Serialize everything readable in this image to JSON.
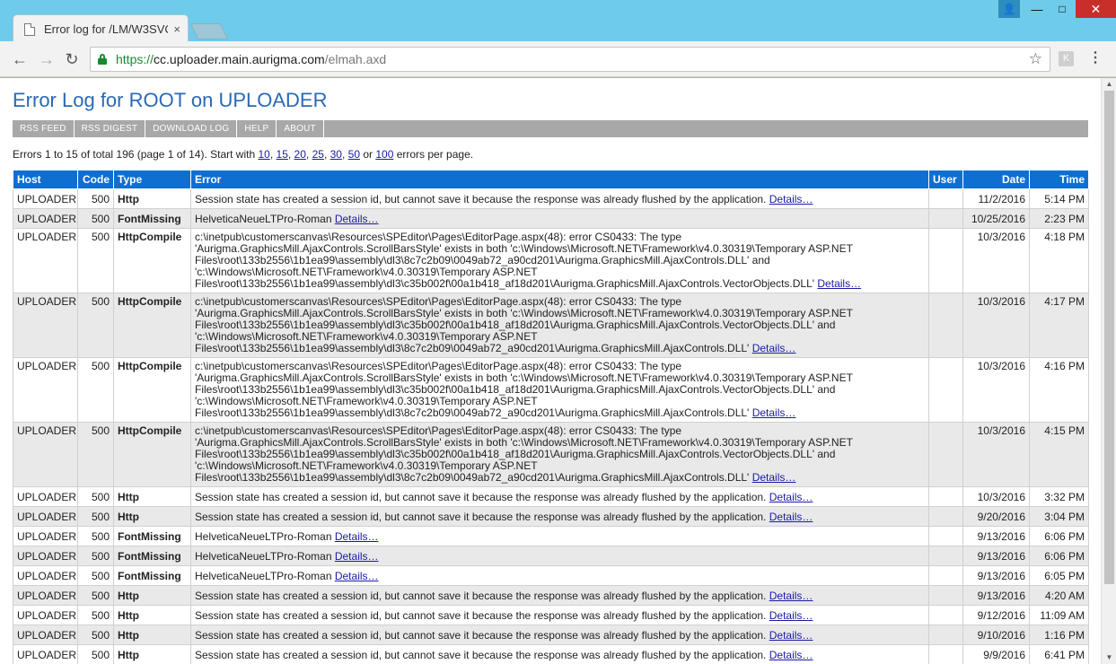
{
  "browser": {
    "tab_title": "Error log for /LM/W3SVC",
    "tab_close": "×",
    "url_scheme": "https://",
    "url_host": "cc.uploader.main.aurigma.com",
    "url_path": "/elmah.axd",
    "extension_label": "K",
    "icons": {
      "back": "←",
      "forward": "→",
      "reload": "↻",
      "star": "☆",
      "menu": "⋮",
      "user": "👤",
      "minimize": "—",
      "maximize": "□",
      "close": "✕"
    }
  },
  "page": {
    "title": "Error Log for ROOT on UPLOADER",
    "speedbar": [
      "RSS FEED",
      "RSS DIGEST",
      "DOWNLOAD LOG",
      "HELP",
      "ABOUT"
    ],
    "info_prefix": "Errors 1 to 15 of total 196 (page 1 of 14). Start with ",
    "page_sizes": [
      "10",
      "15",
      "20",
      "25",
      "30",
      "50",
      "100"
    ],
    "info_or": " or ",
    "info_suffix": " errors per page.",
    "columns": [
      "Host",
      "Code",
      "Type",
      "Error",
      "User",
      "Date",
      "Time"
    ],
    "details_label": "Details…",
    "rows": [
      {
        "host": "UPLOADER",
        "code": "500",
        "type": "Http",
        "error": "Session state has created a session id, but cannot save it because the response was already flushed by the application.",
        "user": "",
        "date": "11/2/2016",
        "time": "5:14 PM"
      },
      {
        "host": "UPLOADER",
        "code": "500",
        "type": "FontMissing",
        "error": "HelveticaNeueLTPro-Roman",
        "user": "",
        "date": "10/25/2016",
        "time": "2:23 PM"
      },
      {
        "host": "UPLOADER",
        "code": "500",
        "type": "HttpCompile",
        "error": "c:\\inetpub\\customerscanvas\\Resources\\SPEditor\\Pages\\EditorPage.aspx(48): error CS0433: The type 'Aurigma.GraphicsMill.AjaxControls.ScrollBarsStyle' exists in both 'c:\\Windows\\Microsoft.NET\\Framework\\v4.0.30319\\Temporary ASP.NET Files\\root\\133b2556\\1b1ea99\\assembly\\dl3\\8c7c2b09\\0049ab72_a90cd201\\Aurigma.GraphicsMill.AjaxControls.DLL' and 'c:\\Windows\\Microsoft.NET\\Framework\\v4.0.30319\\Temporary ASP.NET Files\\root\\133b2556\\1b1ea99\\assembly\\dl3\\c35b002f\\00a1b418_af18d201\\Aurigma.GraphicsMill.AjaxControls.VectorObjects.DLL'",
        "user": "",
        "date": "10/3/2016",
        "time": "4:18 PM"
      },
      {
        "host": "UPLOADER",
        "code": "500",
        "type": "HttpCompile",
        "error": "c:\\inetpub\\customerscanvas\\Resources\\SPEditor\\Pages\\EditorPage.aspx(48): error CS0433: The type 'Aurigma.GraphicsMill.AjaxControls.ScrollBarsStyle' exists in both 'c:\\Windows\\Microsoft.NET\\Framework\\v4.0.30319\\Temporary ASP.NET Files\\root\\133b2556\\1b1ea99\\assembly\\dl3\\c35b002f\\00a1b418_af18d201\\Aurigma.GraphicsMill.AjaxControls.VectorObjects.DLL' and 'c:\\Windows\\Microsoft.NET\\Framework\\v4.0.30319\\Temporary ASP.NET Files\\root\\133b2556\\1b1ea99\\assembly\\dl3\\8c7c2b09\\0049ab72_a90cd201\\Aurigma.GraphicsMill.AjaxControls.DLL'",
        "user": "",
        "date": "10/3/2016",
        "time": "4:17 PM"
      },
      {
        "host": "UPLOADER",
        "code": "500",
        "type": "HttpCompile",
        "error": "c:\\inetpub\\customerscanvas\\Resources\\SPEditor\\Pages\\EditorPage.aspx(48): error CS0433: The type 'Aurigma.GraphicsMill.AjaxControls.ScrollBarsStyle' exists in both 'c:\\Windows\\Microsoft.NET\\Framework\\v4.0.30319\\Temporary ASP.NET Files\\root\\133b2556\\1b1ea99\\assembly\\dl3\\c35b002f\\00a1b418_af18d201\\Aurigma.GraphicsMill.AjaxControls.VectorObjects.DLL' and 'c:\\Windows\\Microsoft.NET\\Framework\\v4.0.30319\\Temporary ASP.NET Files\\root\\133b2556\\1b1ea99\\assembly\\dl3\\8c7c2b09\\0049ab72_a90cd201\\Aurigma.GraphicsMill.AjaxControls.DLL'",
        "user": "",
        "date": "10/3/2016",
        "time": "4:16 PM"
      },
      {
        "host": "UPLOADER",
        "code": "500",
        "type": "HttpCompile",
        "error": "c:\\inetpub\\customerscanvas\\Resources\\SPEditor\\Pages\\EditorPage.aspx(48): error CS0433: The type 'Aurigma.GraphicsMill.AjaxControls.ScrollBarsStyle' exists in both 'c:\\Windows\\Microsoft.NET\\Framework\\v4.0.30319\\Temporary ASP.NET Files\\root\\133b2556\\1b1ea99\\assembly\\dl3\\c35b002f\\00a1b418_af18d201\\Aurigma.GraphicsMill.AjaxControls.VectorObjects.DLL' and 'c:\\Windows\\Microsoft.NET\\Framework\\v4.0.30319\\Temporary ASP.NET Files\\root\\133b2556\\1b1ea99\\assembly\\dl3\\8c7c2b09\\0049ab72_a90cd201\\Aurigma.GraphicsMill.AjaxControls.DLL'",
        "user": "",
        "date": "10/3/2016",
        "time": "4:15 PM"
      },
      {
        "host": "UPLOADER",
        "code": "500",
        "type": "Http",
        "error": "Session state has created a session id, but cannot save it because the response was already flushed by the application.",
        "user": "",
        "date": "10/3/2016",
        "time": "3:32 PM"
      },
      {
        "host": "UPLOADER",
        "code": "500",
        "type": "Http",
        "error": "Session state has created a session id, but cannot save it because the response was already flushed by the application.",
        "user": "",
        "date": "9/20/2016",
        "time": "3:04 PM"
      },
      {
        "host": "UPLOADER",
        "code": "500",
        "type": "FontMissing",
        "error": "HelveticaNeueLTPro-Roman",
        "user": "",
        "date": "9/13/2016",
        "time": "6:06 PM"
      },
      {
        "host": "UPLOADER",
        "code": "500",
        "type": "FontMissing",
        "error": "HelveticaNeueLTPro-Roman",
        "user": "",
        "date": "9/13/2016",
        "time": "6:06 PM"
      },
      {
        "host": "UPLOADER",
        "code": "500",
        "type": "FontMissing",
        "error": "HelveticaNeueLTPro-Roman",
        "user": "",
        "date": "9/13/2016",
        "time": "6:05 PM"
      },
      {
        "host": "UPLOADER",
        "code": "500",
        "type": "Http",
        "error": "Session state has created a session id, but cannot save it because the response was already flushed by the application.",
        "user": "",
        "date": "9/13/2016",
        "time": "4:20 AM"
      },
      {
        "host": "UPLOADER",
        "code": "500",
        "type": "Http",
        "error": "Session state has created a session id, but cannot save it because the response was already flushed by the application.",
        "user": "",
        "date": "9/12/2016",
        "time": "11:09 AM"
      },
      {
        "host": "UPLOADER",
        "code": "500",
        "type": "Http",
        "error": "Session state has created a session id, but cannot save it because the response was already flushed by the application.",
        "user": "",
        "date": "9/10/2016",
        "time": "1:16 PM"
      },
      {
        "host": "UPLOADER",
        "code": "500",
        "type": "Http",
        "error": "Session state has created a session id, but cannot save it because the response was already flushed by the application.",
        "user": "",
        "date": "9/9/2016",
        "time": "6:41 PM"
      }
    ]
  }
}
